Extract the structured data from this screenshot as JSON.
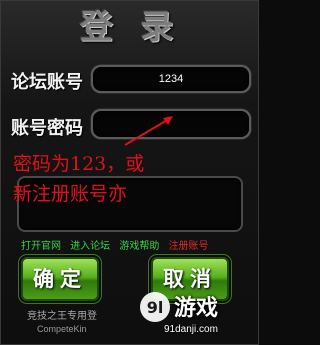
{
  "window": {
    "title": "登 录"
  },
  "form": {
    "username_label": "论坛账号",
    "username_value": "1234",
    "password_label": "账号密码",
    "password_value": ""
  },
  "annotation": {
    "line1": "密码为123，或",
    "line2": "新注册账号亦",
    "color": "#e0101a"
  },
  "links": [
    {
      "label": "打开官网",
      "color": "#39d14a"
    },
    {
      "label": "进入论坛",
      "color": "#39d14a"
    },
    {
      "label": "游戏帮助",
      "color": "#39d14a"
    },
    {
      "label": "注册账号",
      "color": "#e02a2a"
    }
  ],
  "buttons": {
    "confirm_label": "确定",
    "cancel_label": "取消"
  },
  "footer": {
    "line1": "竞技之王专用登",
    "line2": "CompeteKin"
  },
  "watermark": {
    "logo_text": "9l",
    "brand": "游戏",
    "url": "91danji.com"
  }
}
